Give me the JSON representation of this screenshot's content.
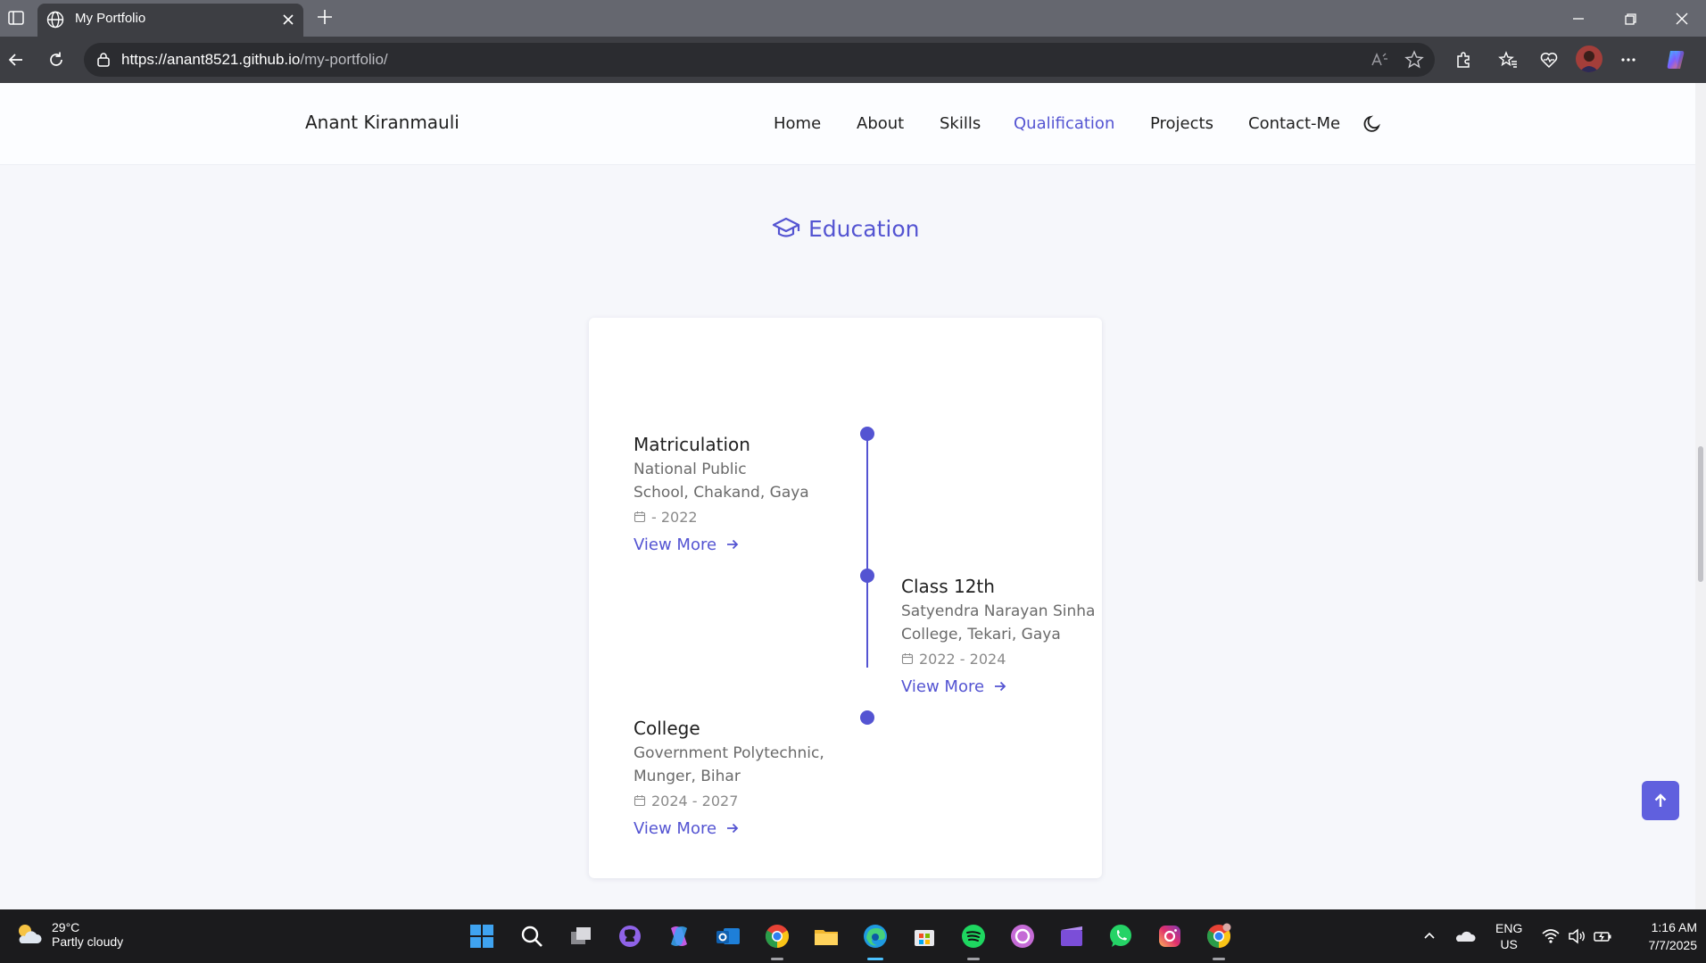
{
  "browser": {
    "tab_title": "My Portfolio",
    "url_host": "https://anant8521.github.io",
    "url_path": "/my-portfolio/"
  },
  "site": {
    "brand": "Anant Kiranmauli",
    "nav": [
      "Home",
      "About",
      "Skills",
      "Qualification",
      "Projects",
      "Contact-Me"
    ],
    "active_nav": "Qualification",
    "accent": "#5454d2"
  },
  "section": {
    "title": "Education",
    "icon": "graduation-cap-icon"
  },
  "education": [
    {
      "name": "Matriculation",
      "inst_line1": "National Public",
      "inst_line2": "School, Chakand, Gaya",
      "date": "- 2022",
      "more": "View More"
    },
    {
      "name": "Class 12th",
      "inst_line1": "Satyendra Narayan Sinha",
      "inst_line2": "College, Tekari, Gaya",
      "date": "2022 - 2024",
      "more": "View More"
    },
    {
      "name": "College",
      "inst_line1": "Government Polytechnic,",
      "inst_line2": "Munger, Bihar",
      "date": "2024 - 2027",
      "more": "View More"
    }
  ],
  "taskbar": {
    "weather_temp": "29°C",
    "weather_cond": "Partly cloudy",
    "lang_top": "ENG",
    "lang_bottom": "US",
    "time": "1:16 AM",
    "date": "7/7/2025"
  }
}
